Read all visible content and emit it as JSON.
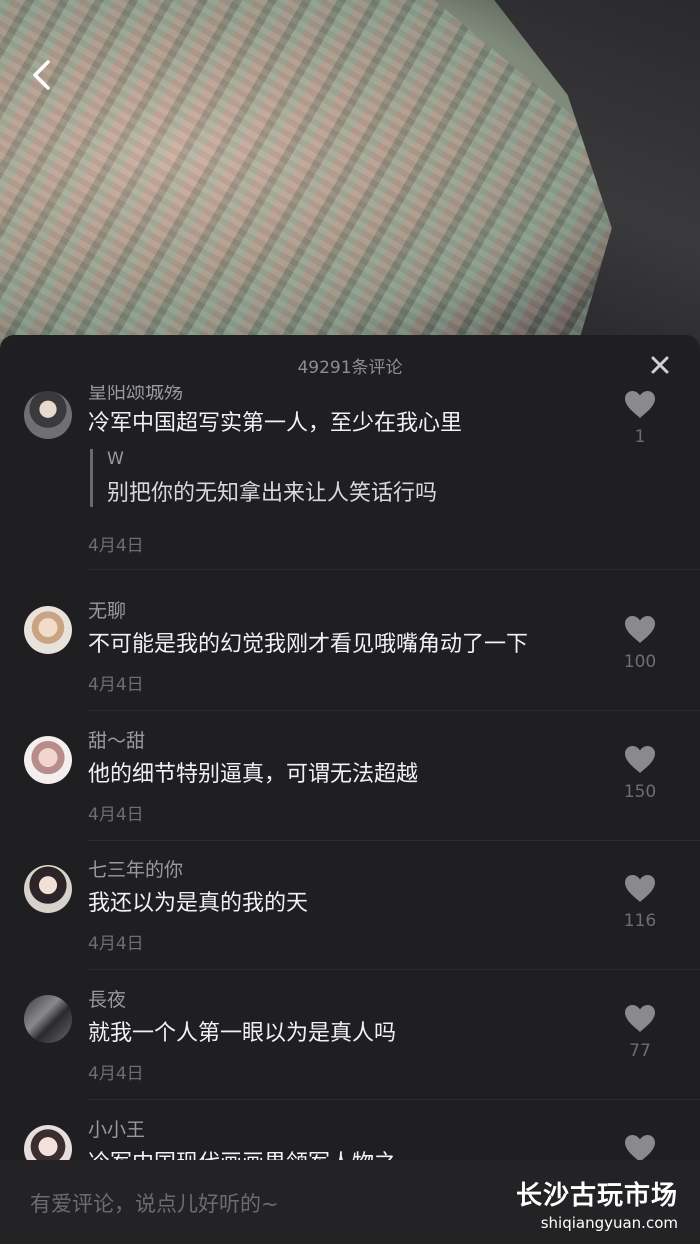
{
  "header": {
    "title": "49291条评论"
  },
  "comments": [
    {
      "username": "皇阳颂城殇",
      "text": "冷军中国超写实第一人，至少在我心里",
      "reply_user": "W",
      "reply_text": "别把你的无知拿出来让人笑话行吗",
      "date": "4月4日",
      "likes": "1"
    },
    {
      "username": "无聊",
      "text": "不可能是我的幻觉我刚才看见哦嘴角动了一下",
      "date": "4月4日",
      "likes": "100"
    },
    {
      "username": "甜～甜",
      "text": "他的细节特别逼真，可谓无法超越",
      "date": "4月4日",
      "likes": "150"
    },
    {
      "username": "七三年的你",
      "text": "我还以为是真的我的天",
      "date": "4月4日",
      "likes": "116"
    },
    {
      "username": "長夜",
      "text": "就我一个人第一眼以为是真人吗",
      "date": "4月4日",
      "likes": "77"
    },
    {
      "username": "小小王",
      "text": "冷军中国现代画画界领军人物之一"
    }
  ],
  "input": {
    "placeholder": "有爱评论，说点儿好听的~"
  },
  "watermark": {
    "title": "长沙古玩市场",
    "url": "shiqiangyuan.com"
  }
}
